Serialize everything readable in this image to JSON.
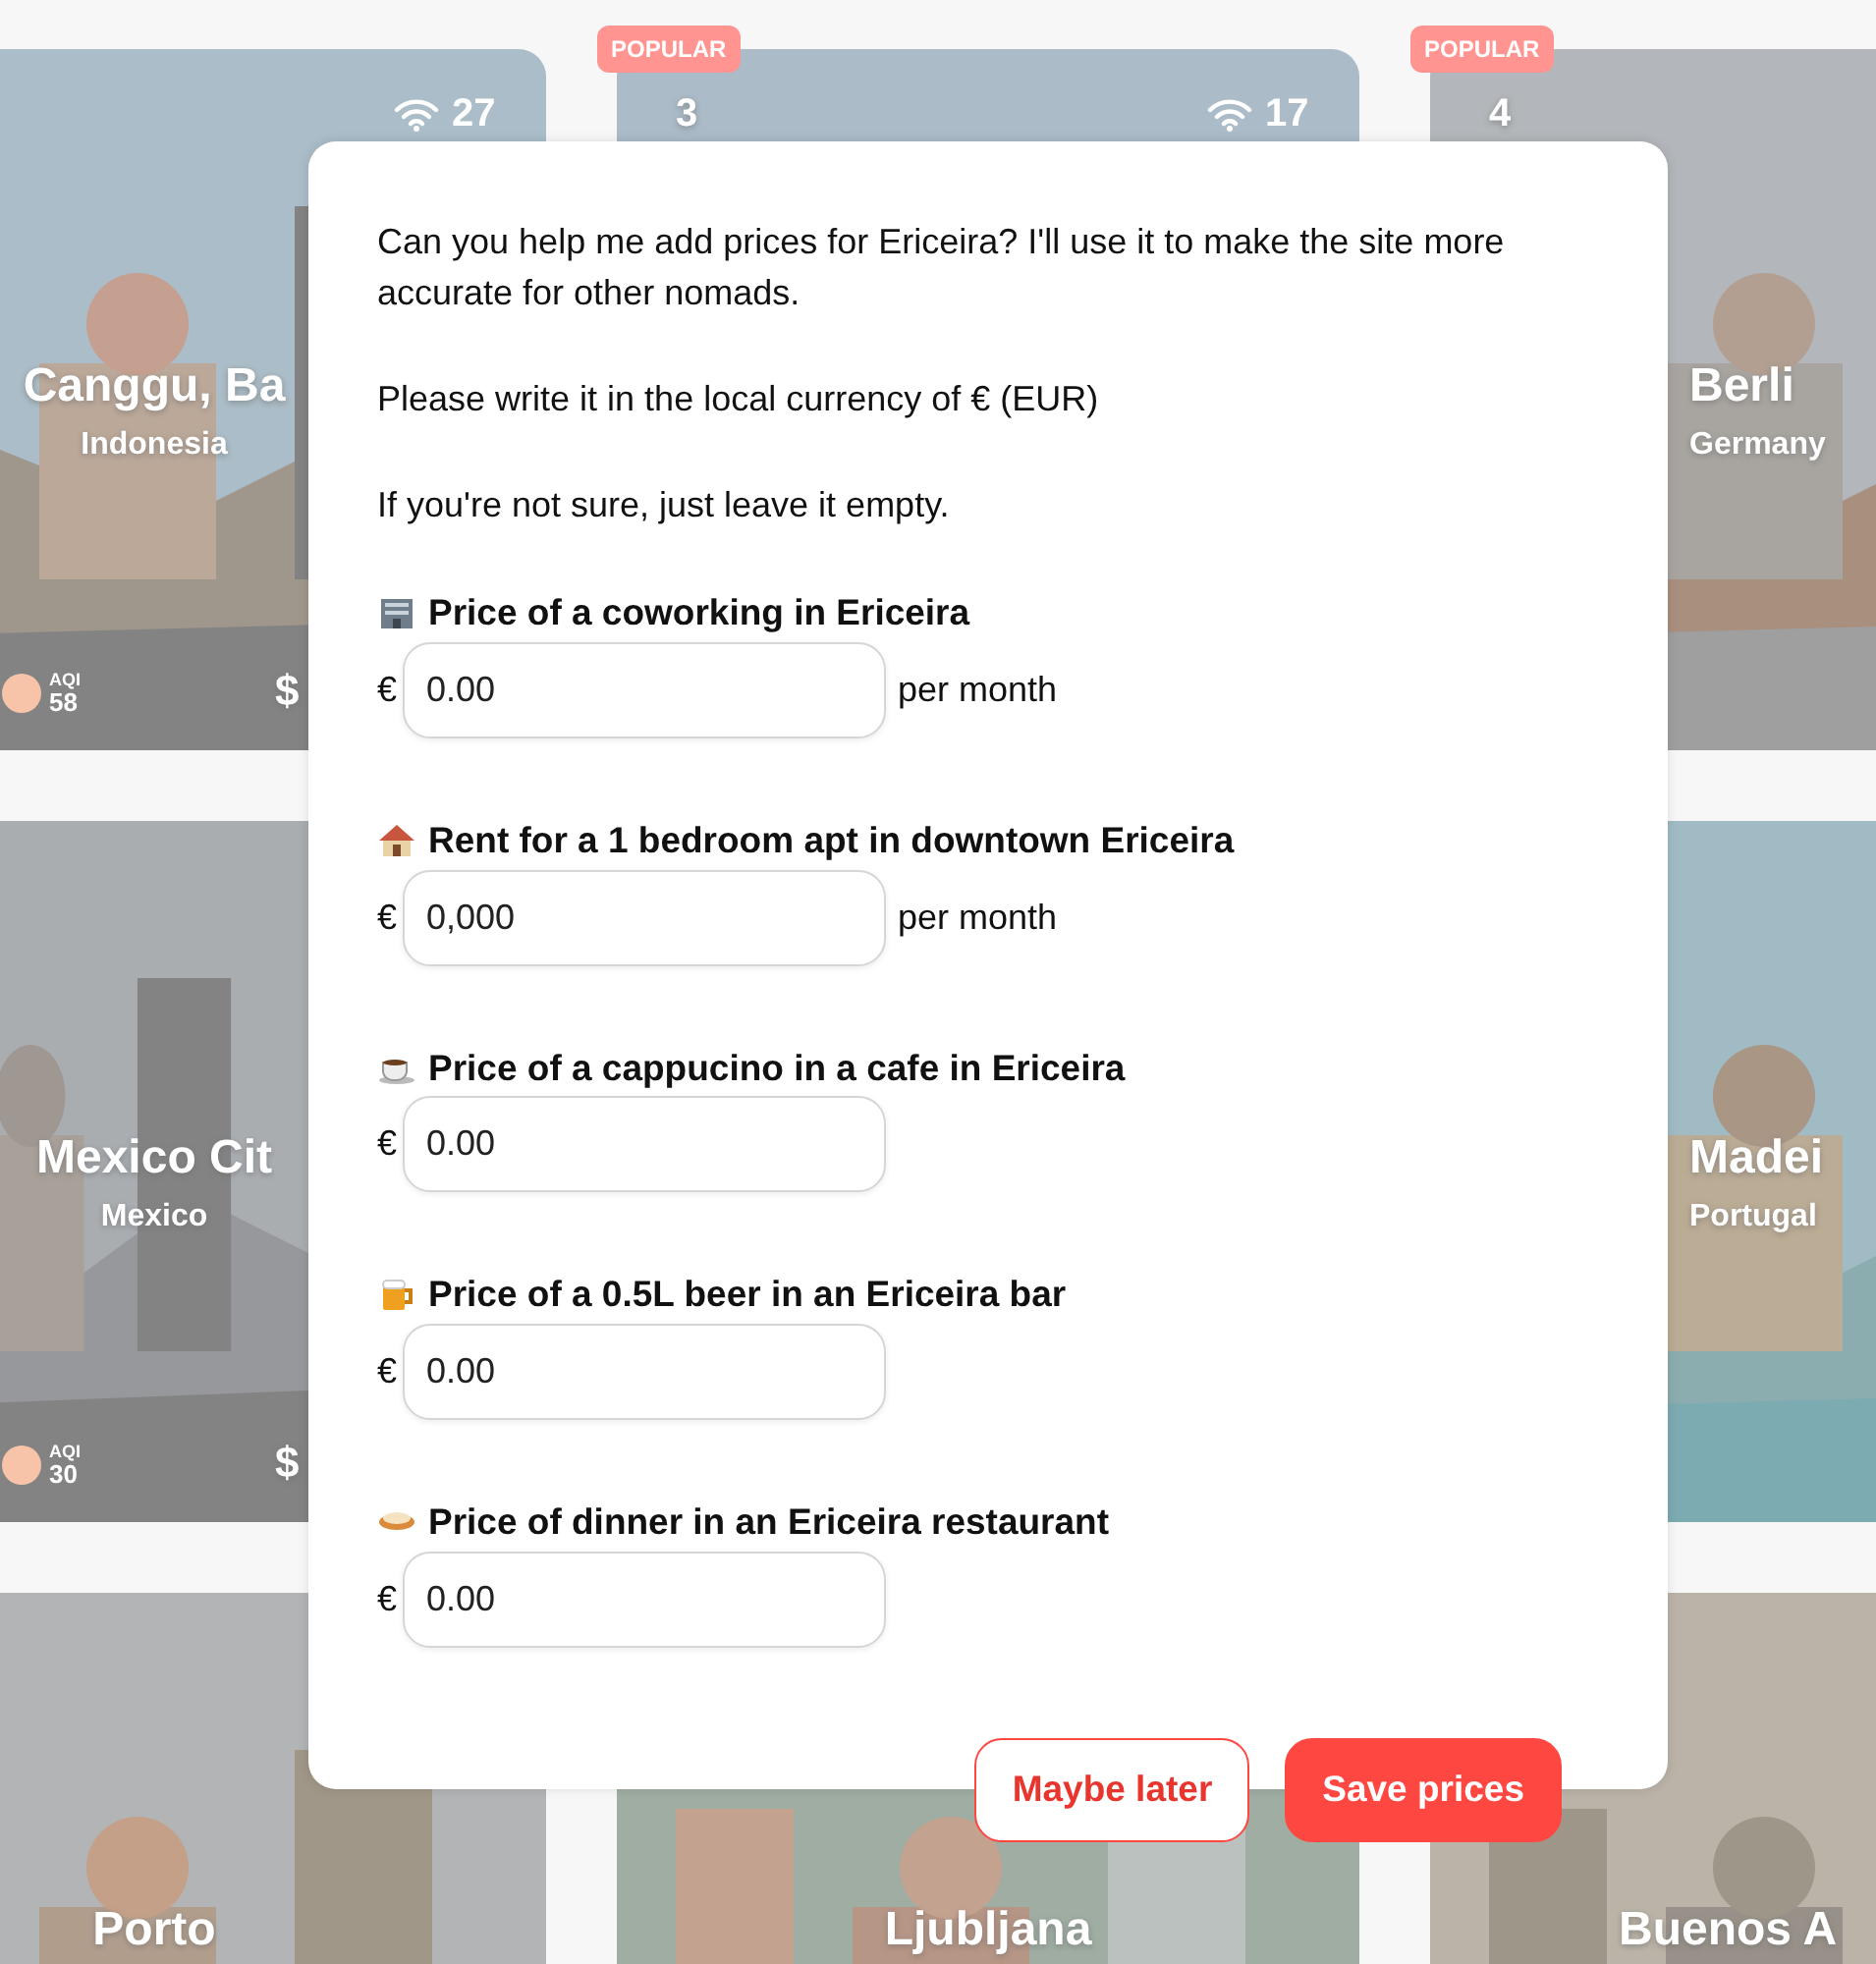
{
  "cards": [
    {
      "kind": "card",
      "wifi": "27",
      "title": "Canggu, Ba",
      "subtitle": "Indonesia",
      "aqi_label": "AQI",
      "aqi": "58",
      "cost": "$"
    },
    {
      "kind": "card",
      "badge": "POPULAR",
      "rank": "3",
      "wifi": "17"
    },
    {
      "kind": "card",
      "badge": "POPULAR",
      "rank": "4",
      "title": "Berli",
      "subtitle": "Germany"
    },
    {
      "kind": "card",
      "title": "Mexico Cit",
      "subtitle": "Mexico",
      "aqi_label": "AQI",
      "aqi": "30",
      "cost": "$"
    },
    {
      "kind": "hidden"
    },
    {
      "kind": "card",
      "title": "Madei",
      "subtitle": "Portugal"
    },
    {
      "kind": "card",
      "title": "Porto"
    },
    {
      "kind": "card",
      "title": "Ljubljana"
    },
    {
      "kind": "card",
      "title": "Buenos A"
    }
  ],
  "modal": {
    "paragraphs": [
      "Can you help me add prices for Ericeira? I'll use it to make the site more accurate for other nomads.",
      "Please write it in the local currency of € (EUR)",
      "If you're not sure, just leave it empty."
    ],
    "questions": [
      {
        "label": "Price of a coworking in Ericeira",
        "currency": "€",
        "placeholder": "0.00",
        "unit": "per month"
      },
      {
        "label": "Rent for a 1 bedroom apt in downtown Ericeira",
        "currency": "€",
        "placeholder": "0,000",
        "unit": "per month"
      },
      {
        "label": "Price of a cappucino in a cafe in Ericeira",
        "currency": "€",
        "placeholder": "0.00"
      },
      {
        "label": "Price of a 0.5L beer in an Ericeira bar",
        "currency": "€",
        "placeholder": "0.00"
      },
      {
        "label": "Price of dinner in an Ericeira restaurant",
        "currency": "€",
        "placeholder": "0.00"
      }
    ],
    "buttons": [
      {
        "label": "Maybe later",
        "kind": "secondary"
      },
      {
        "label": "Save prices",
        "kind": "primary"
      }
    ]
  }
}
